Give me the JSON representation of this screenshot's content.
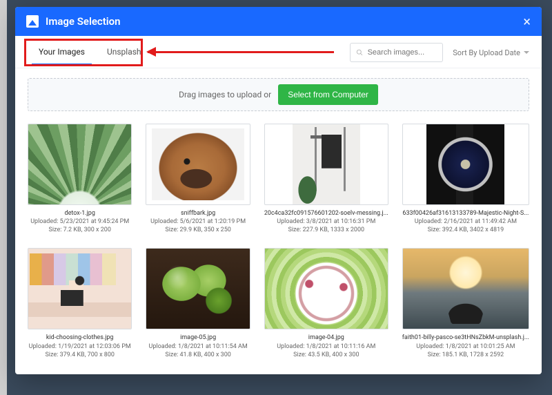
{
  "header": {
    "title": "Image Selection"
  },
  "tabs": {
    "your_images": "Your Images",
    "unsplash": "Unsplash"
  },
  "search": {
    "placeholder": "Search images..."
  },
  "sort": {
    "label": "Sort By Upload Date"
  },
  "dropzone": {
    "text": "Drag images to upload or",
    "button": "Select from Computer"
  },
  "images": [
    {
      "filename": "detox-1.jpg",
      "uploaded": "Uploaded: 5/23/2021 at 9:45:24 PM",
      "size": "Size: 7.2 KB, 300 x 200"
    },
    {
      "filename": "sniffbark.jpg",
      "uploaded": "Uploaded: 5/6/2021 at 1:20:19 PM",
      "size": "Size: 29.9 KB, 350 x 250"
    },
    {
      "filename": "20c4ca32fc091576601202-soelv-messing.j...",
      "uploaded": "Uploaded: 3/8/2021 at 10:16:31 PM",
      "size": "Size: 227.9 KB, 1333 x 2000"
    },
    {
      "filename": "633f00426af31613133789-Majestic-Night-S...",
      "uploaded": "Uploaded: 2/16/2021 at 11:49:42 AM",
      "size": "Size: 392.4 KB, 3402 x 4819"
    },
    {
      "filename": "kid-choosing-clothes.jpg",
      "uploaded": "Uploaded: 1/19/2021 at 12:03:06 PM",
      "size": "Size: 379.4 KB, 700 x 800"
    },
    {
      "filename": "image-05.jpg",
      "uploaded": "Uploaded: 1/8/2021 at 10:11:54 AM",
      "size": "Size: 41.8 KB, 400 x 300"
    },
    {
      "filename": "image-04.jpg",
      "uploaded": "Uploaded: 1/8/2021 at 10:11:16 AM",
      "size": "Size: 43.5 KB, 400 x 300"
    },
    {
      "filename": "faith01-billy-pasco-se3tHNsZbkM-unsplash.j...",
      "uploaded": "Uploaded: 1/8/2021 at 10:01:25 AM",
      "size": "Size: 185.1 KB, 1728 x 2592"
    }
  ]
}
